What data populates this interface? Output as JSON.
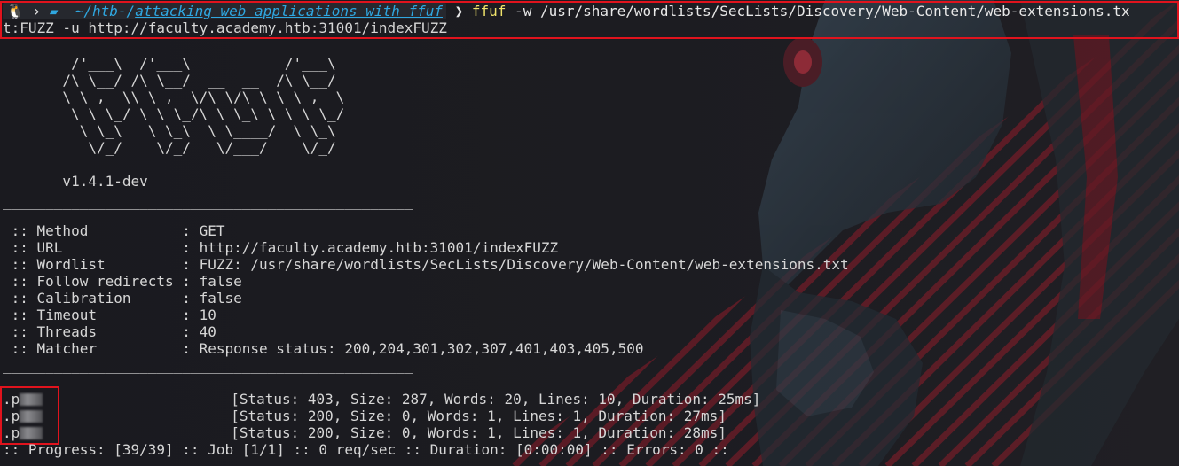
{
  "prompt": {
    "os_glyph": "🐧",
    "sep": "›",
    "dir_icon": "▰",
    "path_prefix": "~/htb-/",
    "path_dir": "attacking_web_applications_with_ffuf",
    "command": "ffuf",
    "args_line1": " -w /usr/share/wordlists/SecLists/Discovery/Web-Content/web-extensions.tx",
    "args_line2": "t:FUZZ -u http://faculty.academy.htb:31001/indexFUZZ"
  },
  "banner": {
    "ascii": [
      "        /'___\\  /'___\\           /'___\\       ",
      "       /\\ \\__/ /\\ \\__/  __  __  /\\ \\__/       ",
      "       \\ \\ ,__\\\\ \\ ,__\\/\\ \\/\\ \\ \\ \\ ,__\\      ",
      "        \\ \\ \\_/ \\ \\ \\_/\\ \\ \\_\\ \\ \\ \\ \\_/      ",
      "         \\ \\_\\   \\ \\_\\  \\ \\____/  \\ \\_\\       ",
      "          \\/_/    \\/_/   \\/___/    \\/_/       "
    ],
    "version": "       v1.4.1-dev"
  },
  "separator": "________________________________________________",
  "config": [
    {
      "key": " :: Method           ",
      "value": ": GET"
    },
    {
      "key": " :: URL              ",
      "value": ": http://faculty.academy.htb:31001/indexFUZZ"
    },
    {
      "key": " :: Wordlist         ",
      "value": ": FUZZ: /usr/share/wordlists/SecLists/Discovery/Web-Content/web-extensions.txt"
    },
    {
      "key": " :: Follow redirects ",
      "value": ": false"
    },
    {
      "key": " :: Calibration      ",
      "value": ": false"
    },
    {
      "key": " :: Timeout          ",
      "value": ": 10"
    },
    {
      "key": " :: Threads          ",
      "value": ": 40"
    },
    {
      "key": " :: Matcher          ",
      "value": ": Response status: 200,204,301,302,307,401,403,405,500"
    }
  ],
  "results": [
    {
      "prefix": ".p",
      "status": "[Status: 403, Size: 287, Words: 20, Lines: 10, Duration: 25ms]"
    },
    {
      "prefix": ".p",
      "status": "[Status: 200, Size: 0, Words: 1, Lines: 1, Duration: 27ms]"
    },
    {
      "prefix": ".p",
      "status": "[Status: 200, Size: 0, Words: 1, Lines: 1, Duration: 28ms]"
    }
  ],
  "progress": ":: Progress: [39/39] :: Job [1/1] :: 0 req/sec :: Duration: [0:00:00] :: Errors: 0 ::",
  "colors": {
    "highlight_box": "#e0131d",
    "path": "#2fa7e0",
    "command": "#f0e36a",
    "text": "#d6d6d6"
  }
}
